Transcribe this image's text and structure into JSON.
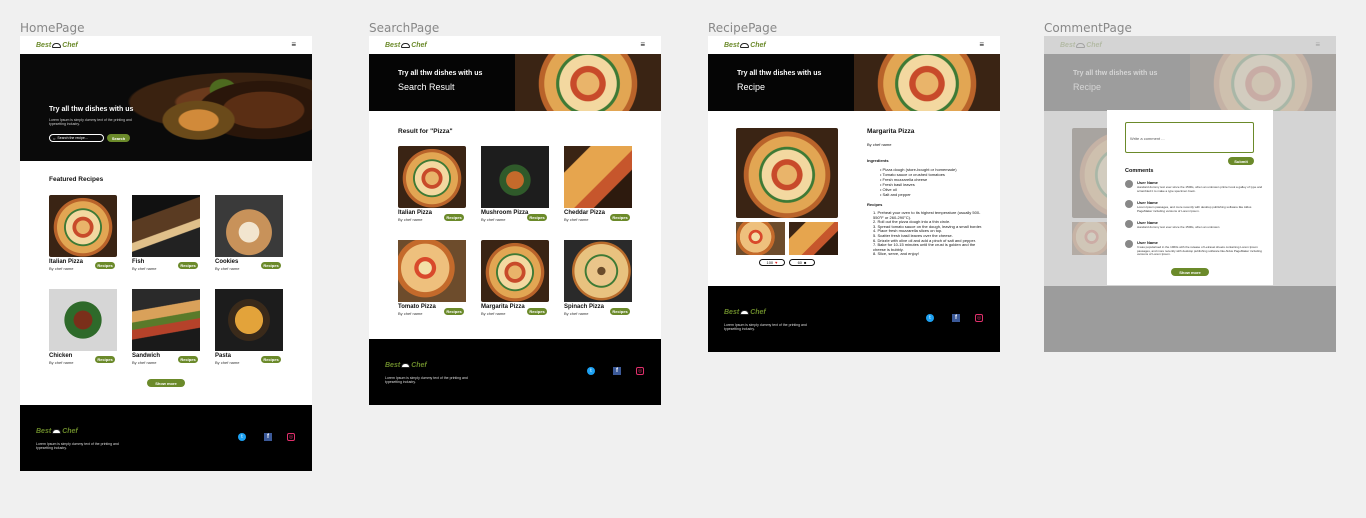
{
  "frames": {
    "home": "HomePage",
    "search": "SearchPage",
    "recipe": "RecipePage",
    "comment": "CommentPage"
  },
  "brand": {
    "logo_left": "Best",
    "logo_right": "Chef",
    "accent": "#6b8a2a",
    "footer_text": "Lorem Ipsum is simply dummy text of the printing and typesetting industry."
  },
  "icons": {
    "menu": "menu-icon",
    "twitter": "twitter-icon",
    "facebook": "facebook-icon",
    "instagram": "instagram-icon"
  },
  "home": {
    "hero_title": "Try all thw dishes with us",
    "hero_desc": "Lorem Ipsum is simply dummy text of the printing and typesetting industry.",
    "search_placeholder": "Search the recipe...",
    "search_button": "Search",
    "featured_title": "Featured Recipes",
    "cards": [
      {
        "title": "Italian Pizza",
        "sub": "By chef name",
        "btn": "Recipes"
      },
      {
        "title": "Fish",
        "sub": "By chef name",
        "btn": "Recipes"
      },
      {
        "title": "Cookies",
        "sub": "By chef name",
        "btn": "Recipes"
      },
      {
        "title": "Chicken",
        "sub": "By chef name",
        "btn": "Recipes"
      },
      {
        "title": "Sandwich",
        "sub": "By chef name",
        "btn": "Recipes"
      },
      {
        "title": "Pasta",
        "sub": "By chef name",
        "btn": "Recipes"
      }
    ],
    "show_more": "Show more"
  },
  "search": {
    "hero_title": "Try all thw dishes with us",
    "hero_sub": "Search Result",
    "result_title": "Result for \"Pizza\"",
    "cards": [
      {
        "title": "Italian Pizza",
        "sub": "By chef name",
        "btn": "Recipes"
      },
      {
        "title": "Mushroom Pizza",
        "sub": "By chef name",
        "btn": "Recipes"
      },
      {
        "title": "Cheddar Pizza",
        "sub": "By chef name",
        "btn": "Recipes"
      },
      {
        "title": "Tomato Pizza",
        "sub": "By chef name",
        "btn": "Recipes"
      },
      {
        "title": "Margarita Pizza",
        "sub": "By chef name",
        "btn": "Recipes"
      },
      {
        "title": "Spinach Pizza",
        "sub": "By chef name",
        "btn": "Recipes"
      }
    ]
  },
  "recipe": {
    "hero_title": "Try all thw dishes with us",
    "hero_sub": "Recipe",
    "name": "Margarita Pizza",
    "chef": "By chef name",
    "ingredients_title": "Ingredients",
    "ingredients": [
      "Pizza dough (store-bought or homemade)",
      "Tomato sauce or crushed tomatoes",
      "Fresh mozzarella cheese",
      "Fresh basil leaves",
      "Olive oil",
      "Salt and pepper"
    ],
    "recipes_title": "Recipes",
    "steps": [
      "1. Preheat your oven to its highest temperature (usually 500-550°F or 260-290°C).",
      "2. Roll out the pizza dough into a thin circle.",
      "3. Spread tomato sauce on the dough, leaving a small border.",
      "4. Place fresh mozzarella slices on top.",
      "5. Scatter fresh basil leaves over the cheese.",
      "6. Drizzle with olive oil and add a pinch of salt and pepper.",
      "7. Bake for 10-15 minutes until the crust is golden and the cheese is bubbly.",
      "8. Slice, serve, and enjoy!"
    ],
    "likes": "100",
    "comments": "60"
  },
  "comment": {
    "placeholder": "Write a comment ...",
    "submit": "Submit",
    "comments_title": "Comments",
    "user": "User Name",
    "comments": [
      "standard dummy text ever since the 1500s, when an unknown printer took a galley of type and scrambled it to make a type specimen book.",
      "Lorem Ipsum passages, and more recently with desktop publishing software like Aldus PageMaker including versions of Lorem Ipsum.",
      "standard dummy text ever since the 1500s, when an unknown",
      "It was popularised in the 1960s with the release of Letraset sheets containing Lorem Ipsum passages, and more recently with desktop publishing software like Aldus PageMaker including versions of Lorem Ipsum."
    ],
    "show_more": "Show more"
  }
}
